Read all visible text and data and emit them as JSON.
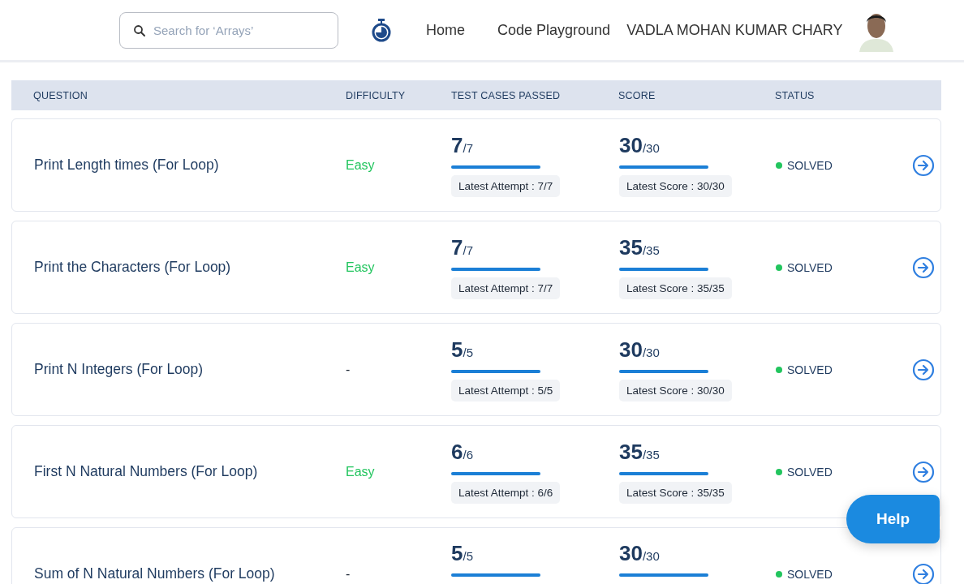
{
  "header": {
    "search": {
      "placeholder": "Search for ‘Arrays’"
    },
    "nav": [
      "Home",
      "Code Playground"
    ],
    "user_name": "VADLA MOHAN KUMAR CHARY"
  },
  "table": {
    "columns": [
      "QUESTION",
      "DIFFICULTY",
      "TEST CASES PASSED",
      "SCORE",
      "STATUS"
    ],
    "rows": [
      {
        "question": "Print Length times (For Loop)",
        "difficulty": {
          "label": "Easy",
          "color": "#22c55e"
        },
        "tests": {
          "passed": "7",
          "total": "/7",
          "level": 1,
          "latest": "Latest Attempt : 7/7"
        },
        "score": {
          "value": "30",
          "total": "/30",
          "level": 1,
          "latest": "Latest Score : 30/30"
        },
        "status": {
          "label": "SOLVED",
          "color": "#22c55e"
        }
      },
      {
        "question": "Print the Characters (For Loop)",
        "difficulty": {
          "label": "Easy",
          "color": "#22c55e"
        },
        "tests": {
          "passed": "7",
          "total": "/7",
          "level": 1,
          "latest": "Latest Attempt : 7/7"
        },
        "score": {
          "value": "35",
          "total": "/35",
          "level": 1,
          "latest": "Latest Score : 35/35"
        },
        "status": {
          "label": "SOLVED",
          "color": "#22c55e"
        }
      },
      {
        "question": "Print N Integers (For Loop)",
        "difficulty": {
          "label": "-",
          "color": "#1f2937"
        },
        "tests": {
          "passed": "5",
          "total": "/5",
          "level": 1,
          "latest": "Latest Attempt : 5/5"
        },
        "score": {
          "value": "30",
          "total": "/30",
          "level": 1,
          "latest": "Latest Score : 30/30"
        },
        "status": {
          "label": "SOLVED",
          "color": "#22c55e"
        }
      },
      {
        "question": "First N Natural Numbers (For Loop)",
        "difficulty": {
          "label": "Easy",
          "color": "#22c55e"
        },
        "tests": {
          "passed": "6",
          "total": "/6",
          "level": 1,
          "latest": "Latest Attempt : 6/6"
        },
        "score": {
          "value": "35",
          "total": "/35",
          "level": 1,
          "latest": "Latest Score : 35/35"
        },
        "status": {
          "label": "SOLVED",
          "color": "#22c55e"
        }
      },
      {
        "question": "Sum of N Natural Numbers (For Loop)",
        "difficulty": {
          "label": "-",
          "color": "#1f2937"
        },
        "tests": {
          "passed": "5",
          "total": "/5",
          "level": 1
        },
        "score": {
          "value": "30",
          "total": "/30",
          "level": 1
        },
        "status": {
          "label": "SOLVED",
          "color": "#22c55e"
        }
      }
    ]
  },
  "help_button": "Help"
}
